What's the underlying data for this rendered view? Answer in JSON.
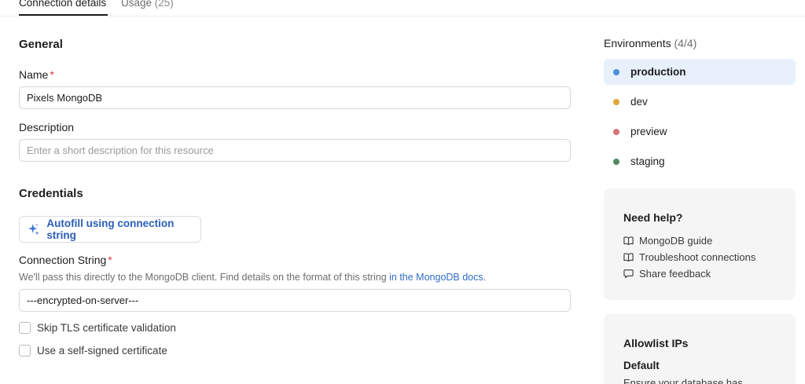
{
  "tabs": [
    {
      "label": "Connection details",
      "count": ""
    },
    {
      "label": "Usage",
      "count": "(25)"
    }
  ],
  "general": {
    "title": "General",
    "name_label": "Name",
    "name_value": "Pixels MongoDB",
    "description_label": "Description",
    "description_placeholder": "Enter a short description for this resource",
    "required_mark": "*"
  },
  "credentials": {
    "title": "Credentials",
    "autofill_label": "Autofill using connection string",
    "connection_label": "Connection String",
    "helper_text": "We'll pass this directly to the MongoDB client. Find details on the format of this string ",
    "helper_link": "in the MongoDB docs",
    "helper_end": ".",
    "connection_value": "---encrypted-on-server---",
    "skip_tls_label": "Skip TLS certificate validation",
    "self_signed_label": "Use a self-signed certificate"
  },
  "environments": {
    "title": "Environments",
    "count": "(4/4)",
    "items": [
      {
        "label": "production",
        "color": "#4a90d9"
      },
      {
        "label": "dev",
        "color": "#e0a83a"
      },
      {
        "label": "preview",
        "color": "#d9737a"
      },
      {
        "label": "staging",
        "color": "#4f8a5f"
      }
    ]
  },
  "help": {
    "title": "Need help?",
    "links": [
      "MongoDB guide",
      "Troubleshoot connections",
      "Share feedback"
    ]
  },
  "allowlist": {
    "title": "Allowlist IPs",
    "subtitle": "Default",
    "text": "Ensure your database has"
  }
}
